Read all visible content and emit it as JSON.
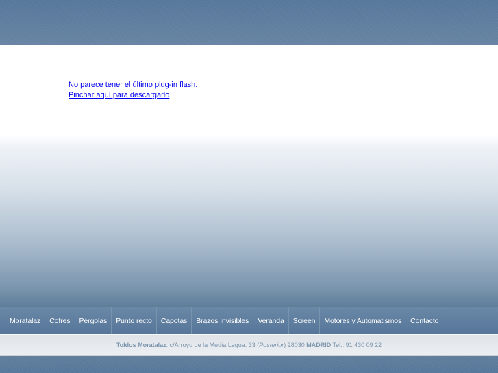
{
  "flash_notice": {
    "line1": "No parece tener el último plug-in flash.",
    "line2": "Pinchar aquí para descargarlo"
  },
  "nav": {
    "items": [
      {
        "label": "Moratalaz"
      },
      {
        "label": "Cofres"
      },
      {
        "label": "Pérgolas"
      },
      {
        "label": "Punto recto"
      },
      {
        "label": "Capotas"
      },
      {
        "label": "Brazos Invisibles"
      },
      {
        "label": "Veranda"
      },
      {
        "label": "Screen"
      },
      {
        "label": "Motores y Automatismos"
      },
      {
        "label": "Contacto"
      }
    ]
  },
  "footer": {
    "company": "Toldos Moratalaz",
    "sep": ".",
    "address": " c/Arroyo de la Media Legua. 33 (",
    "address_note": "Posterior",
    "postal": ") 28030 ",
    "city": "MADRID",
    "phone": " Tel.: 91 430 09 22"
  },
  "colors": {
    "brand_blue": "#5f7d98",
    "link": "#0000ee",
    "footer_text": "#7d96ae"
  }
}
